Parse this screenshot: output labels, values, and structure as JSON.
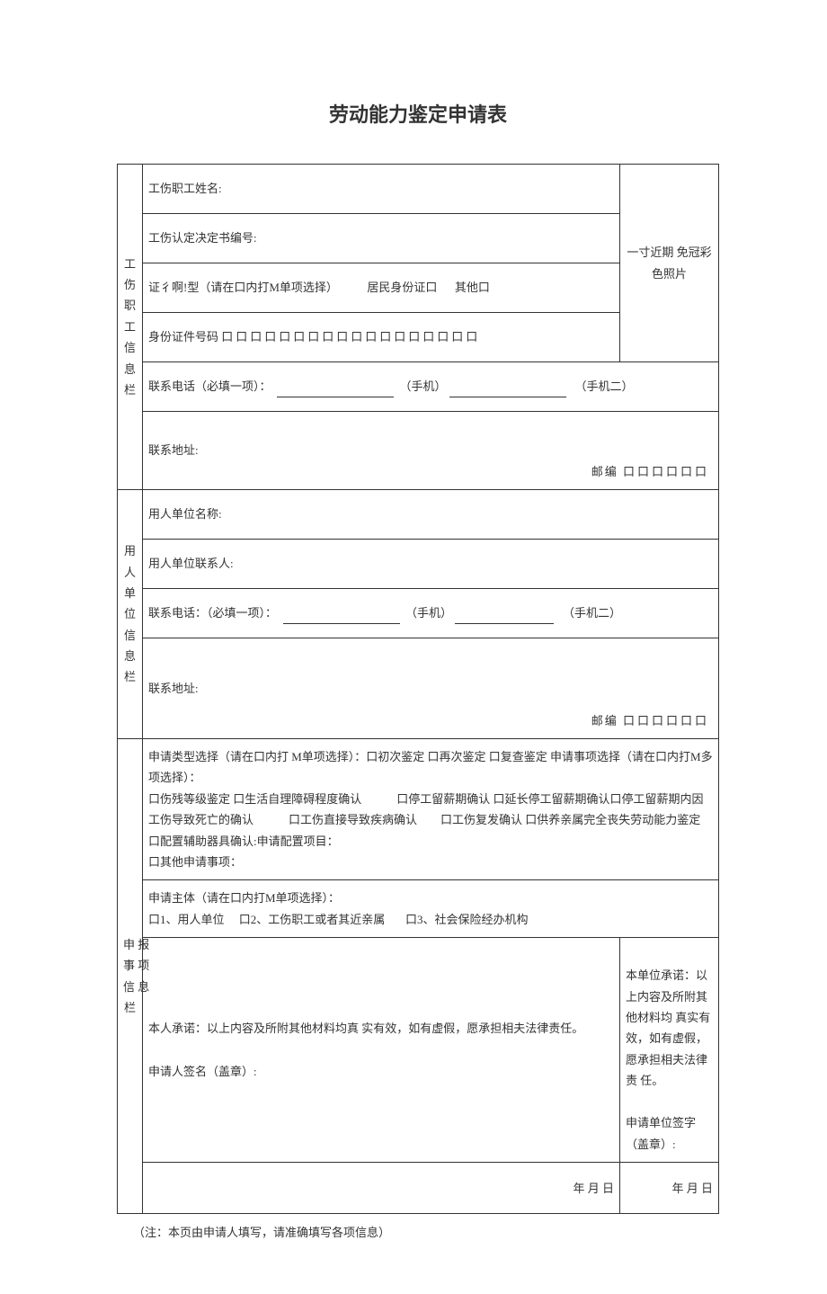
{
  "title": "劳动能力鉴定申请表",
  "section1_label": "工伤职工信息栏",
  "section2_label": "用人单位信息栏",
  "section3_label": "申报事项信息栏",
  "worker": {
    "name_label": "工伤职工姓名:",
    "decision_no_label": "工伤认定决定书编号:",
    "id_type_label": "证彳啊!型（请在口内打M单项选择）",
    "id_type_opt1": "居民身份证口",
    "id_type_opt2": "其他口",
    "id_no_label": "身份证件号码",
    "id_boxes": "口口口口口口口口口口口口口口口口口口",
    "phone_label": "联系电话（必填一项）：",
    "phone_m1": "（手机）",
    "phone_m2": "（手机二）",
    "addr_label": "联系地址:",
    "postal_label": "邮编",
    "postal_boxes": "口口口口口口"
  },
  "photo": "一寸近期 免冠彩色照片",
  "employer": {
    "name_label": "用人单位名称:",
    "contact_label": "用人单位联系人:",
    "phone_label": "联系电话：（必填一项）：",
    "phone_m1": "（手机）",
    "phone_m2": "（手机二）",
    "addr_label": "联系地址:",
    "postal_label": "邮编",
    "postal_boxes": "口口口口口口"
  },
  "apply": {
    "type_text": "申请类型选择（请在口内打 M单项选择）：口初次鉴定 口再次鉴定 口复查鉴定 申请事项选择（请在口内打M多项选择）：\n口伤残等级鉴定 口生活自理障碍程度确认　　　口停工留薪期确认 口延长停工留薪期确认口停工留薪期内因工伤导致死亡的确认　　　口工伤直接导致疾病确认　　口工伤复发确认 口供养亲属完全丧失劳动能力鉴定　　　口配置辅助器具确认:申请配置项目：\n口其他申请事项：",
    "subject_label": "申请主体（请在口内打M单项选择）：",
    "subject_opt1": "口1、用人单位",
    "subject_opt2": "口2、工伤职工或者其近亲属",
    "subject_opt3": "口3、社会保险经办机构",
    "declare_person": "本人承诺：以上内容及所附其他材料均真 实有效，如有虚假，愿承担相夫法律责任。",
    "sign_person": "申请人签名（盖章）:",
    "declare_unit": "本单位承诺：以上内容及所附其他材料均 真实有效，如有虚假，愿承担相夫法律责 任。",
    "sign_unit": "申请单位签字（盖章）:",
    "date": "年 月 日"
  },
  "footnote": "（注：本页由申请人填写，请准确填写各项信息）"
}
